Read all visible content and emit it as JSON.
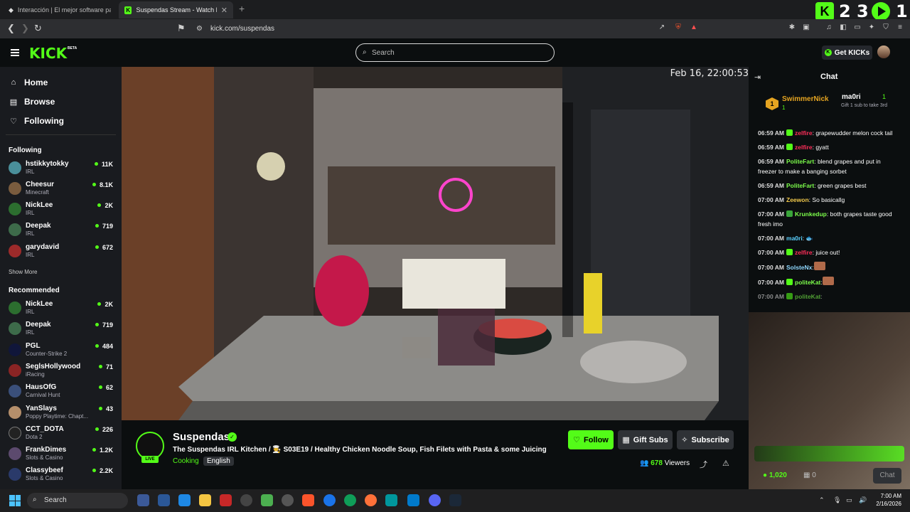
{
  "browser": {
    "tabs": [
      {
        "label": "Interacción | El mejor software para p"
      },
      {
        "label": "Suspendas Stream - Watch Li"
      }
    ],
    "url": "kick.com/suspendas",
    "counter": "2 3",
    "counter2": "1"
  },
  "header": {
    "logo": "KICK",
    "beta": "BETA",
    "search_placeholder": "Search",
    "get_kicks": "Get KICKs"
  },
  "sidebar": {
    "nav": [
      {
        "label": "Home"
      },
      {
        "label": "Browse"
      },
      {
        "label": "Following"
      }
    ],
    "following_heading": "Following",
    "following": [
      {
        "name": "hstikkytokky",
        "category": "IRL",
        "viewers": "11K"
      },
      {
        "name": "Cheesur",
        "category": "Minecraft",
        "viewers": "8.1K"
      },
      {
        "name": "NickLee",
        "category": "IRL",
        "viewers": "2K"
      },
      {
        "name": "Deepak",
        "category": "IRL",
        "viewers": "719"
      },
      {
        "name": "garydavid",
        "category": "IRL",
        "viewers": "672"
      }
    ],
    "show_more": "Show More",
    "recommended_heading": "Recommended",
    "recommended": [
      {
        "name": "NickLee",
        "category": "IRL",
        "viewers": "2K"
      },
      {
        "name": "Deepak",
        "category": "IRL",
        "viewers": "719"
      },
      {
        "name": "PGL",
        "category": "Counter-Strike 2",
        "viewers": "484"
      },
      {
        "name": "SeglsHollywood",
        "category": "iRacing",
        "viewers": "71"
      },
      {
        "name": "HausOfG",
        "category": "Carnival Hunt",
        "viewers": "62"
      },
      {
        "name": "YanSlays",
        "category": "Poppy Playtime: Chapt...",
        "viewers": "43"
      },
      {
        "name": "CCT_DOTA",
        "category": "Dota 2",
        "viewers": "226"
      },
      {
        "name": "FrankDimes",
        "category": "Slots & Casino",
        "viewers": "1.2K"
      },
      {
        "name": "Classybeef",
        "category": "Slots & Casino",
        "viewers": "2.2K"
      }
    ]
  },
  "video": {
    "timestamp": "Feb 16, 22:00:53"
  },
  "stream": {
    "live": "LIVE",
    "name": "Suspendas",
    "title": "The Suspendas IRL Kitchen / 🧑‍🍳 S03E19 / Healthy Chicken Noodle Soup, Fish Filets with Pasta & some Juicing",
    "category": "Cooking",
    "tag": "English",
    "follow": "Follow",
    "gift": "Gift Subs",
    "subscribe": "Subscribe",
    "viewers": "678",
    "viewers_label": "Viewers"
  },
  "chat": {
    "title": "Chat",
    "pinned": {
      "rank": "1",
      "name": "SwimmerNick",
      "subs": "1",
      "name2": "ma0ri",
      "count2": "1",
      "sub_text": "Gift 1 sub to take 3rd"
    },
    "messages": [
      {
        "time": "06:59 AM",
        "user": "zelfire",
        "color": "#ff2f5a",
        "text": ": grapewudder melon cock tail"
      },
      {
        "time": "06:59 AM",
        "user": "zelfire",
        "color": "#ff2f5a",
        "text": ": gyatt"
      },
      {
        "time": "06:59 AM",
        "user": "PoliteFart",
        "color": "#7cfc4b",
        "text": ": blend grapes and put in freezer to make a banging sorbet"
      },
      {
        "time": "06:59 AM",
        "user": "PoliteFart",
        "color": "#7cfc4b",
        "text": ": green grapes best"
      },
      {
        "time": "07:00 AM",
        "user": "Zeewon",
        "color": "#f2c94c",
        "text": ": So basicallg"
      },
      {
        "time": "07:00 AM",
        "user": "Krunkedup",
        "color": "#7cfc4b",
        "text": ": both grapes taste good fresh imo"
      },
      {
        "time": "07:00 AM",
        "user": "ma0ri",
        "color": "#5ad1ff",
        "text": ": 🐟"
      },
      {
        "time": "07:00 AM",
        "user": "zelfire",
        "color": "#ff2f5a",
        "text": ": juice out!"
      },
      {
        "time": "07:00 AM",
        "user": "SolsteNx",
        "color": "#8fd8ff",
        "text": ":"
      },
      {
        "time": "07:00 AM",
        "user": "politeKat",
        "color": "#7cfc4b",
        "text": ":"
      },
      {
        "time": "07:00 AM",
        "user": "politeKat",
        "color": "#7cfc4b",
        "text": ":"
      }
    ],
    "kicks": "1,020",
    "zero": "0",
    "chat_button": "Chat"
  },
  "taskbar": {
    "search": "Search",
    "time": "7:00 AM",
    "date": "2/16/2026"
  }
}
